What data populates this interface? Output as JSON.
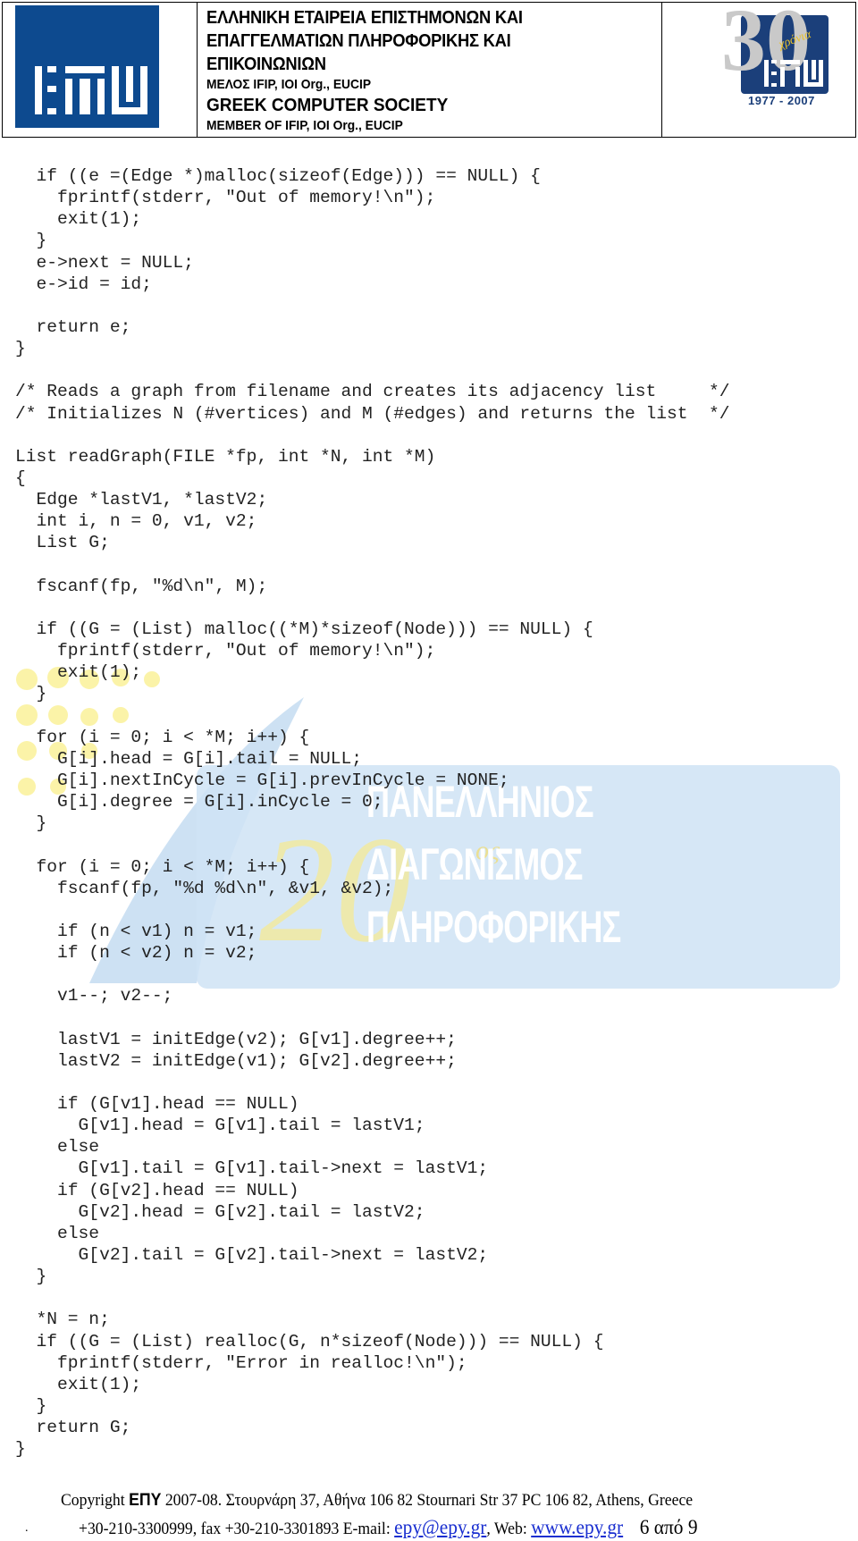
{
  "header": {
    "org_greek_lines": [
      "ΕΛΛΗΝΙΚΗ ΕΤΑΙΡΕΙΑ ΕΠΙΣΤΗΜΟΝΩΝ ΚΑΙ",
      "ΕΠΑΓΓΕΛΜΑΤΙΩΝ ΠΛΗΡΟΦΟΡΙΚΗΣ ΚΑΙ",
      "ΕΠΙΚΟΙΝΩΝΙΩΝ"
    ],
    "member_greek": "ΜΕΛΟΣ IFIP, IOI Org., EUCIP",
    "org_english": "GREEK COMPUTER SOCIETY",
    "member_english": "MEMBER OF IFIP, IOI Org., EUCIP",
    "logo_icon": "epy-logo",
    "anniversary": {
      "number": "30",
      "word": "χρόνια",
      "years": "1977 - 2007"
    },
    "colors": {
      "logo_blue": "#0d4a8f",
      "anniv_navy": "#1b3f7a",
      "anniv_gold": "#e9c22a"
    }
  },
  "watermark": {
    "words": [
      "ΠΑΝΕΛΛΗΝΙΟΣ",
      "ΔΙΑΓΩΝΙΣΜΟΣ",
      "ΠΛΗΡΟΦΟΡΙΚΗΣ"
    ],
    "number": "20",
    "suffix": "ος"
  },
  "code": {
    "language": "C",
    "lines": [
      "  if ((e =(Edge *)malloc(sizeof(Edge))) == NULL) {",
      "    fprintf(stderr, \"Out of memory!\\n\");",
      "    exit(1);",
      "  }",
      "  e->next = NULL;",
      "  e->id = id;",
      "",
      "  return e;",
      "}",
      "",
      "/* Reads a graph from filename and creates its adjacency list     */",
      "/* Initializes N (#vertices) and M (#edges) and returns the list  */",
      "",
      "List readGraph(FILE *fp, int *N, int *M)",
      "{",
      "  Edge *lastV1, *lastV2;",
      "  int i, n = 0, v1, v2;",
      "  List G;",
      "",
      "  fscanf(fp, \"%d\\n\", M);",
      "",
      "  if ((G = (List) malloc((*M)*sizeof(Node))) == NULL) {",
      "    fprintf(stderr, \"Out of memory!\\n\");",
      "    exit(1);",
      "  }",
      "",
      "  for (i = 0; i < *M; i++) {",
      "    G[i].head = G[i].tail = NULL;",
      "    G[i].nextInCycle = G[i].prevInCycle = NONE;",
      "    G[i].degree = G[i].inCycle = 0;",
      "  }",
      "",
      "  for (i = 0; i < *M; i++) {",
      "    fscanf(fp, \"%d %d\\n\", &v1, &v2);",
      "",
      "    if (n < v1) n = v1;",
      "    if (n < v2) n = v2;",
      "",
      "    v1--; v2--;",
      "",
      "    lastV1 = initEdge(v2); G[v1].degree++;",
      "    lastV2 = initEdge(v1); G[v2].degree++;",
      "",
      "    if (G[v1].head == NULL)",
      "      G[v1].head = G[v1].tail = lastV1;",
      "    else",
      "      G[v1].tail = G[v1].tail->next = lastV1;",
      "    if (G[v2].head == NULL)",
      "      G[v2].head = G[v2].tail = lastV2;",
      "    else",
      "      G[v2].tail = G[v2].tail->next = lastV2;",
      "  }",
      "",
      "  *N = n;",
      "  if ((G = (List) realloc(G, n*sizeof(Node))) == NULL) {",
      "    fprintf(stderr, \"Error in realloc!\\n\");",
      "    exit(1);",
      "  }",
      "  return G;",
      "}"
    ]
  },
  "footer": {
    "copyright_prefix": "Copyright ",
    "brand": "ΕΠΥ",
    "copyright_rest": " 2007-08. Στουρνάρη 37, Αθήνα 106 82 Stournari Str 37 PC 106 82, Athens, Greece",
    "phone_fax": "+30-210-3300999, fax +30-210-3301893 E-mail: ",
    "email": "epy@epy.gr",
    "web_label": ", Web: ",
    "web": "www.epy.gr",
    "page": "6 από 9",
    "dot": ".",
    "link_color": "#1a2fd0"
  }
}
